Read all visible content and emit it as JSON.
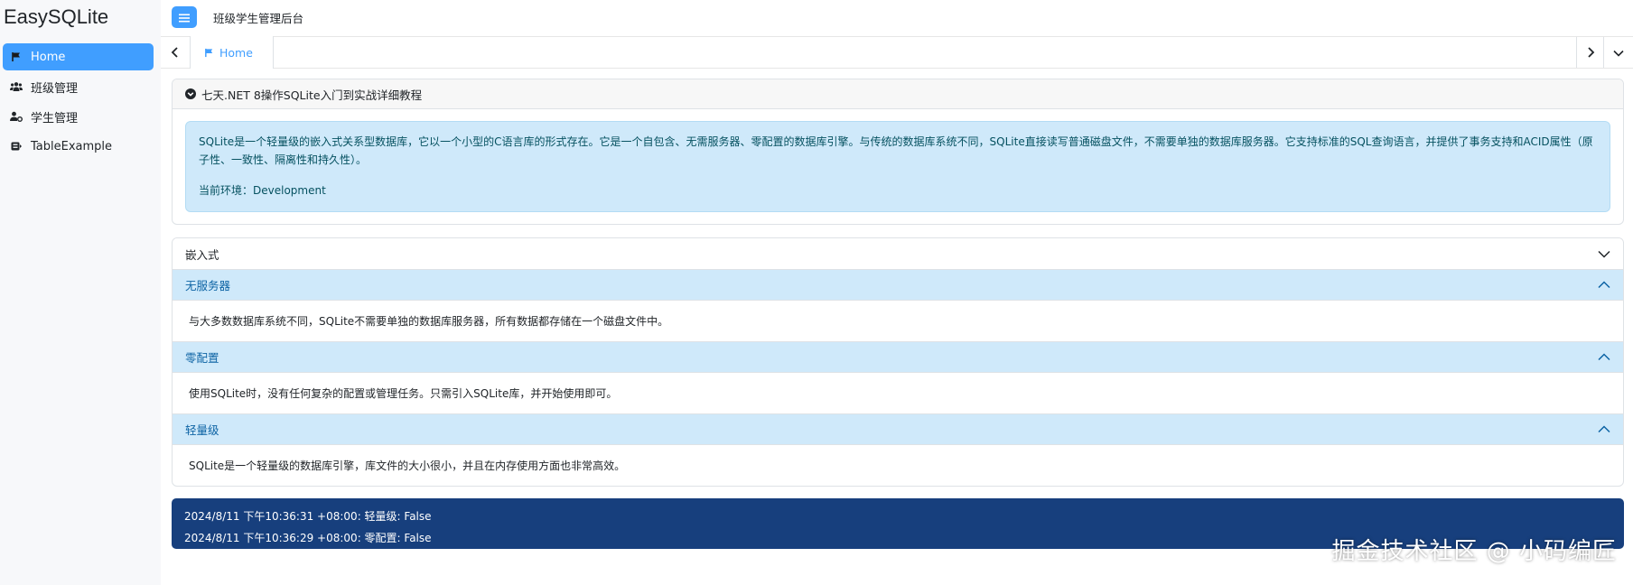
{
  "app": {
    "brand": "EasySQLite",
    "header_title": "班级学生管理后台"
  },
  "sidebar": {
    "items": [
      {
        "label": "Home",
        "icon": "flag-icon",
        "active": true
      },
      {
        "label": "班级管理",
        "icon": "users-icon",
        "active": false
      },
      {
        "label": "学生管理",
        "icon": "user-gear-icon",
        "active": false
      },
      {
        "label": "TableExample",
        "icon": "table-icon",
        "active": false
      }
    ]
  },
  "tabs": [
    {
      "label": "Home",
      "icon": "flag-icon",
      "active": true
    }
  ],
  "intro": {
    "title": "七天.NET 8操作SQLite入门到实战详细教程",
    "description": "SQLite是一个轻量级的嵌入式关系型数据库，它以一个小型的C语言库的形式存在。它是一个自包含、无需服务器、零配置的数据库引擎。与传统的数据库系统不同，SQLite直接读写普通磁盘文件，不需要单独的数据库服务器。它支持标准的SQL查询语言，并提供了事务支持和ACID属性（原子性、一致性、隔离性和持久性）。",
    "env_text": "当前环境：Development"
  },
  "accordion": {
    "items": [
      {
        "title": "嵌入式",
        "open": false,
        "body": ""
      },
      {
        "title": "无服务器",
        "open": true,
        "body": "与大多数数据库系统不同，SQLite不需要单独的数据库服务器，所有数据都存储在一个磁盘文件中。"
      },
      {
        "title": "零配置",
        "open": true,
        "body": "使用SQLite时，没有任何复杂的配置或管理任务。只需引入SQLite库，并开始使用即可。"
      },
      {
        "title": "轻量级",
        "open": true,
        "body": "SQLite是一个轻量级的数据库引擎，库文件的大小很小，并且在内存使用方面也非常高效。"
      }
    ]
  },
  "log": {
    "lines": [
      "2024/8/11 下午10:36:31 +08:00: 轻量级: False",
      "2024/8/11 下午10:36:29 +08:00: 零配置: False"
    ]
  },
  "watermark": "掘金技术社区 @ 小码编匠",
  "colors": {
    "primary": "#409eff",
    "info_bg": "#cfe9fa",
    "log_bg": "#173f7d"
  }
}
